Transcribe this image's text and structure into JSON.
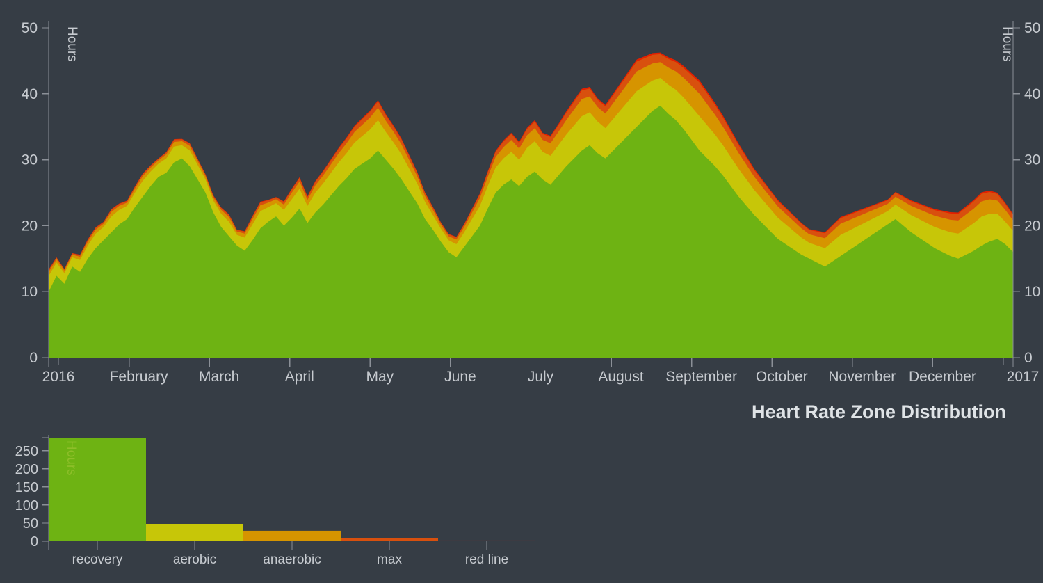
{
  "page": {
    "background_color": "#363d45",
    "title": "Heart Rate Zone Distribution"
  },
  "colors": {
    "recovery": "#6eb313",
    "aerobic": "#c7c608",
    "anaerobic": "#d69400",
    "max": "#d8500e",
    "red_line": "#e32000",
    "axis": "#8b9097",
    "text": "#c7cbd0",
    "title_text": "#dfe3e6",
    "background": "#363d45"
  },
  "area_chart": {
    "y_axis_left_title": "Hours",
    "y_axis_right_title": "Hours",
    "y_ticks": [
      0,
      10,
      20,
      30,
      40,
      50
    ],
    "y_range": [
      0,
      52
    ],
    "x_tick_labels": [
      "2016",
      "February",
      "March",
      "April",
      "May",
      "June",
      "July",
      "August",
      "September",
      "October",
      "November",
      "December",
      "2017"
    ]
  },
  "bar_chart": {
    "y_axis_title": "Hours",
    "y_ticks": [
      0,
      50,
      100,
      150,
      200,
      250
    ],
    "y_range": [
      0,
      290
    ],
    "categories": [
      "recovery",
      "aerobic",
      "anaerobic",
      "max",
      "red line"
    ]
  },
  "chart_data": [
    {
      "type": "area",
      "stacked": true,
      "title": "Heart Rate Zone Distribution",
      "xlabel": "",
      "ylabel": "Hours",
      "ylim": [
        0,
        52
      ],
      "ytick_values": [
        0,
        10,
        20,
        30,
        40,
        50
      ],
      "xtick_labels": [
        "2016",
        "February",
        "March",
        "April",
        "May",
        "June",
        "July",
        "August",
        "September",
        "October",
        "November",
        "December",
        "2017"
      ],
      "grid": false,
      "legend": "none",
      "dual_y_axis": true,
      "x": [
        "2016-01-01",
        "2016-01-04",
        "2016-01-07",
        "2016-01-10",
        "2016-01-13",
        "2016-01-16",
        "2016-01-19",
        "2016-01-22",
        "2016-01-25",
        "2016-01-28",
        "2016-01-31",
        "2016-02-03",
        "2016-02-06",
        "2016-02-09",
        "2016-02-12",
        "2016-02-15",
        "2016-02-18",
        "2016-02-21",
        "2016-02-24",
        "2016-02-27",
        "2016-03-01",
        "2016-03-04",
        "2016-03-07",
        "2016-03-10",
        "2016-03-13",
        "2016-03-16",
        "2016-03-19",
        "2016-03-22",
        "2016-03-25",
        "2016-03-28",
        "2016-03-31",
        "2016-04-03",
        "2016-04-06",
        "2016-04-09",
        "2016-04-12",
        "2016-04-15",
        "2016-04-18",
        "2016-04-21",
        "2016-04-24",
        "2016-04-27",
        "2016-04-30",
        "2016-05-03",
        "2016-05-06",
        "2016-05-09",
        "2016-05-12",
        "2016-05-15",
        "2016-05-18",
        "2016-05-21",
        "2016-05-24",
        "2016-05-27",
        "2016-05-30",
        "2016-06-02",
        "2016-06-05",
        "2016-06-08",
        "2016-06-11",
        "2016-06-14",
        "2016-06-17",
        "2016-06-20",
        "2016-06-23",
        "2016-06-26",
        "2016-06-29",
        "2016-07-02",
        "2016-07-05",
        "2016-07-08",
        "2016-07-11",
        "2016-07-14",
        "2016-07-17",
        "2016-07-20",
        "2016-07-23",
        "2016-07-26",
        "2016-07-29",
        "2016-08-01",
        "2016-08-04",
        "2016-08-07",
        "2016-08-10",
        "2016-08-13",
        "2016-08-16",
        "2016-08-19",
        "2016-08-22",
        "2016-08-25",
        "2016-08-28",
        "2016-08-31",
        "2016-09-03",
        "2016-09-06",
        "2016-09-09",
        "2016-09-12",
        "2016-09-15",
        "2016-09-18",
        "2016-09-21",
        "2016-09-24",
        "2016-09-27",
        "2016-09-30",
        "2016-10-03",
        "2016-10-06",
        "2016-10-09",
        "2016-10-12",
        "2016-10-15",
        "2016-10-18",
        "2016-10-21",
        "2016-10-24",
        "2016-10-27",
        "2016-10-30",
        "2016-11-02",
        "2016-11-05",
        "2016-11-08",
        "2016-11-11",
        "2016-11-14",
        "2016-11-17",
        "2016-11-20",
        "2016-11-23",
        "2016-11-26",
        "2016-11-29",
        "2016-12-02",
        "2016-12-05",
        "2016-12-08",
        "2016-12-11",
        "2016-12-14",
        "2016-12-17",
        "2016-12-20",
        "2016-12-23",
        "2016-12-26",
        "2016-12-29",
        "2017-01-01"
      ],
      "series": [
        {
          "name": "recovery",
          "color": "#6eb313",
          "values": [
            10.0,
            12.4,
            11.2,
            13.8,
            13.0,
            15.0,
            16.6,
            17.8,
            19.0,
            20.2,
            21.0,
            22.8,
            24.4,
            26.0,
            27.4,
            28.0,
            29.6,
            30.2,
            29.0,
            27.0,
            25.0,
            22.0,
            19.8,
            18.4,
            17.0,
            16.2,
            17.8,
            19.6,
            20.6,
            21.4,
            20.0,
            21.2,
            22.6,
            20.4,
            22.0,
            23.2,
            24.6,
            26.0,
            27.2,
            28.6,
            29.4,
            30.2,
            31.4,
            30.0,
            28.6,
            27.0,
            25.2,
            23.4,
            21.0,
            19.4,
            17.6,
            16.0,
            15.2,
            16.8,
            18.4,
            20.0,
            22.6,
            25.0,
            26.2,
            27.0,
            26.0,
            27.4,
            28.2,
            27.0,
            26.2,
            27.6,
            29.0,
            30.2,
            31.4,
            32.2,
            31.0,
            30.2,
            31.4,
            32.6,
            33.8,
            35.0,
            36.2,
            37.4,
            38.2,
            37.0,
            36.0,
            34.6,
            33.0,
            31.4,
            30.2,
            29.0,
            27.6,
            26.0,
            24.4,
            23.0,
            21.6,
            20.4,
            19.2,
            18.0,
            17.2,
            16.4,
            15.6,
            15.0,
            14.4,
            13.8,
            14.6,
            15.4,
            16.2,
            17.0,
            17.8,
            18.6,
            19.4,
            20.2,
            21.0,
            20.0,
            19.0,
            18.2,
            17.4,
            16.6,
            16.0,
            15.4,
            15.0,
            15.6,
            16.2,
            17.0,
            17.6,
            18.0,
            17.2,
            16.0
          ]
        },
        {
          "name": "aerobic",
          "color": "#c7c608",
          "values": [
            2.4,
            2.0,
            1.6,
            1.4,
            1.8,
            2.0,
            2.2,
            2.0,
            2.4,
            2.2,
            2.0,
            2.2,
            2.4,
            2.2,
            2.0,
            2.2,
            2.4,
            2.0,
            2.4,
            2.2,
            2.0,
            1.8,
            2.0,
            2.2,
            1.6,
            2.0,
            2.4,
            2.6,
            2.2,
            2.0,
            2.4,
            2.8,
            3.0,
            2.6,
            3.0,
            3.2,
            3.4,
            3.6,
            3.8,
            4.0,
            4.2,
            4.4,
            4.6,
            4.2,
            4.0,
            3.8,
            3.4,
            3.0,
            2.6,
            2.2,
            2.0,
            1.8,
            2.0,
            2.2,
            2.6,
            3.0,
            3.4,
            3.8,
            4.0,
            4.2,
            4.0,
            4.4,
            4.6,
            4.2,
            4.4,
            4.6,
            4.8,
            5.0,
            5.2,
            5.0,
            4.8,
            4.6,
            4.8,
            5.0,
            5.2,
            5.4,
            5.0,
            4.6,
            4.2,
            4.4,
            4.6,
            4.8,
            5.0,
            5.2,
            5.0,
            4.8,
            4.6,
            4.4,
            4.2,
            4.0,
            3.8,
            3.6,
            3.4,
            3.2,
            3.0,
            2.8,
            2.6,
            2.4,
            2.6,
            2.8,
            3.0,
            3.2,
            3.0,
            2.8,
            2.6,
            2.4,
            2.2,
            2.0,
            2.2,
            2.4,
            2.6,
            2.8,
            3.0,
            3.2,
            3.4,
            3.6,
            3.8,
            4.0,
            4.2,
            4.4,
            4.2,
            3.8,
            3.4,
            3.2
          ]
        },
        {
          "name": "anaerobic",
          "color": "#d69400",
          "values": [
            0.6,
            0.5,
            0.4,
            0.4,
            0.5,
            0.6,
            0.6,
            0.5,
            0.7,
            0.6,
            0.5,
            0.6,
            0.7,
            0.6,
            0.5,
            0.6,
            0.7,
            0.6,
            0.7,
            0.6,
            0.5,
            0.5,
            0.6,
            0.7,
            0.5,
            0.6,
            0.8,
            0.9,
            0.7,
            0.6,
            0.8,
            1.0,
            1.1,
            0.9,
            1.1,
            1.2,
            1.3,
            1.4,
            1.5,
            1.6,
            1.7,
            1.8,
            1.9,
            1.7,
            1.6,
            1.5,
            1.3,
            1.1,
            0.9,
            0.8,
            0.6,
            0.6,
            0.7,
            0.8,
            1.0,
            1.2,
            1.4,
            1.6,
            1.7,
            1.8,
            1.7,
            1.9,
            2.0,
            1.8,
            1.9,
            2.0,
            2.2,
            2.4,
            2.6,
            2.4,
            2.2,
            2.2,
            2.4,
            2.6,
            2.8,
            3.0,
            2.8,
            2.6,
            2.4,
            2.6,
            2.8,
            3.0,
            3.2,
            3.4,
            3.2,
            3.0,
            2.8,
            2.6,
            2.4,
            2.2,
            2.0,
            1.9,
            1.8,
            1.7,
            1.6,
            1.5,
            1.4,
            1.3,
            1.4,
            1.5,
            1.6,
            1.7,
            1.6,
            1.5,
            1.4,
            1.3,
            1.2,
            1.1,
            1.2,
            1.3,
            1.4,
            1.5,
            1.6,
            1.7,
            1.8,
            1.9,
            2.0,
            2.1,
            2.2,
            2.3,
            2.2,
            2.0,
            1.8,
            1.6
          ]
        },
        {
          "name": "max",
          "color": "#d8500e",
          "values": [
            0.3,
            0.25,
            0.2,
            0.2,
            0.25,
            0.3,
            0.3,
            0.25,
            0.35,
            0.3,
            0.25,
            0.3,
            0.35,
            0.3,
            0.25,
            0.3,
            0.35,
            0.3,
            0.35,
            0.3,
            0.25,
            0.25,
            0.3,
            0.35,
            0.25,
            0.3,
            0.4,
            0.45,
            0.35,
            0.3,
            0.4,
            0.5,
            0.55,
            0.45,
            0.55,
            0.6,
            0.65,
            0.7,
            0.75,
            0.8,
            0.85,
            0.9,
            0.95,
            0.85,
            0.8,
            0.75,
            0.65,
            0.55,
            0.45,
            0.4,
            0.3,
            0.3,
            0.35,
            0.4,
            0.5,
            0.6,
            0.7,
            0.8,
            0.85,
            0.9,
            0.85,
            0.95,
            1.0,
            0.9,
            0.95,
            1.0,
            1.1,
            1.2,
            1.3,
            1.2,
            1.1,
            1.1,
            1.2,
            1.3,
            1.4,
            1.5,
            1.4,
            1.3,
            1.2,
            1.3,
            1.4,
            1.5,
            1.6,
            1.7,
            1.6,
            1.5,
            1.4,
            1.3,
            1.2,
            1.1,
            1.0,
            0.95,
            0.9,
            0.85,
            0.8,
            0.75,
            0.7,
            0.65,
            0.7,
            0.75,
            0.8,
            0.85,
            0.8,
            0.75,
            0.7,
            0.65,
            0.6,
            0.55,
            0.6,
            0.65,
            0.7,
            0.75,
            0.8,
            0.85,
            0.9,
            0.95,
            1.0,
            1.05,
            1.1,
            1.15,
            1.1,
            1.0,
            0.9,
            0.8
          ]
        },
        {
          "name": "red line",
          "color": "#e32000",
          "values": [
            0.06,
            0.05,
            0.04,
            0.04,
            0.05,
            0.06,
            0.06,
            0.05,
            0.07,
            0.06,
            0.05,
            0.06,
            0.07,
            0.06,
            0.05,
            0.06,
            0.07,
            0.06,
            0.07,
            0.06,
            0.05,
            0.05,
            0.06,
            0.07,
            0.05,
            0.06,
            0.08,
            0.09,
            0.07,
            0.06,
            0.08,
            0.1,
            0.11,
            0.09,
            0.11,
            0.12,
            0.13,
            0.14,
            0.15,
            0.16,
            0.17,
            0.18,
            0.19,
            0.17,
            0.16,
            0.15,
            0.13,
            0.11,
            0.09,
            0.08,
            0.06,
            0.06,
            0.07,
            0.08,
            0.1,
            0.12,
            0.14,
            0.16,
            0.17,
            0.18,
            0.17,
            0.19,
            0.2,
            0.18,
            0.19,
            0.2,
            0.22,
            0.24,
            0.26,
            0.24,
            0.22,
            0.22,
            0.24,
            0.26,
            0.28,
            0.3,
            0.28,
            0.26,
            0.24,
            0.26,
            0.28,
            0.3,
            0.32,
            0.34,
            0.32,
            0.3,
            0.28,
            0.26,
            0.24,
            0.22,
            0.2,
            0.19,
            0.18,
            0.17,
            0.16,
            0.15,
            0.14,
            0.13,
            0.14,
            0.15,
            0.16,
            0.17,
            0.16,
            0.15,
            0.14,
            0.13,
            0.12,
            0.11,
            0.12,
            0.13,
            0.14,
            0.15,
            0.16,
            0.17,
            0.18,
            0.19,
            0.2,
            0.21,
            0.22,
            0.23,
            0.22,
            0.2,
            0.18,
            0.16
          ]
        }
      ]
    },
    {
      "type": "bar",
      "title": "",
      "xlabel": "",
      "ylabel": "Hours",
      "ylim": [
        0,
        290
      ],
      "ytick_values": [
        0,
        50,
        100,
        150,
        200,
        250
      ],
      "categories": [
        "recovery",
        "aerobic",
        "anaerobic",
        "max",
        "red line"
      ],
      "values": [
        286,
        48,
        29,
        8,
        2
      ],
      "colors": [
        "#6eb313",
        "#c7c608",
        "#d69400",
        "#d8500e",
        "#e32000"
      ],
      "grid": false,
      "legend": "none"
    }
  ]
}
